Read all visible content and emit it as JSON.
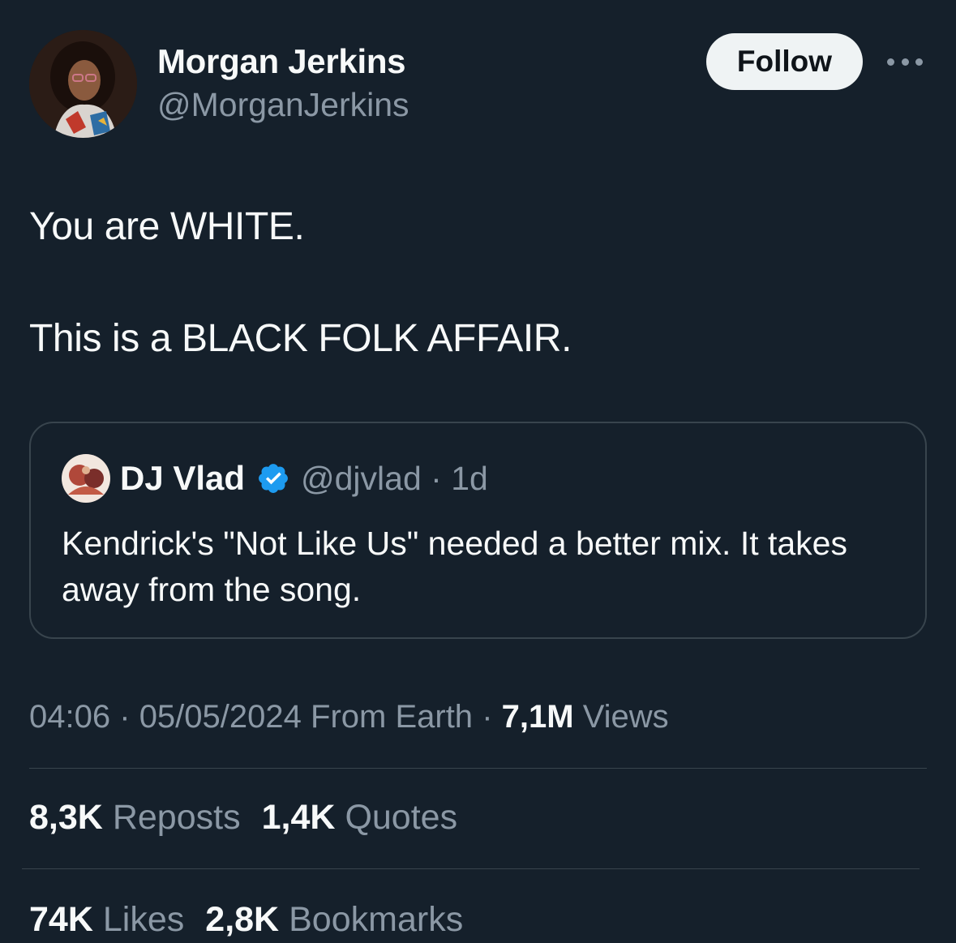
{
  "author": {
    "name": "Morgan Jerkins",
    "handle": "@MorganJerkins"
  },
  "follow_label": "Follow",
  "tweet": {
    "line1": "You are WHITE.",
    "line2": "This is a BLACK FOLK AFFAIR."
  },
  "quote": {
    "name": "DJ Vlad",
    "handle": "@djvlad",
    "separator": "·",
    "age": "1d",
    "text": "Kendrick's \"Not Like Us\" needed a better mix.  It takes away from the song."
  },
  "meta": {
    "time": "04:06",
    "sep1": "·",
    "date": "05/05/2024",
    "source": "From Earth",
    "sep2": "·",
    "views_count": "7,1M",
    "views_label": "Views"
  },
  "stats": {
    "reposts_count": "8,3K",
    "reposts_label": "Reposts",
    "quotes_count": "1,4K",
    "quotes_label": "Quotes",
    "likes_count": "74K",
    "likes_label": "Likes",
    "bookmarks_count": "2,8K",
    "bookmarks_label": "Bookmarks"
  },
  "colors": {
    "background": "#15202b",
    "text": "#f7f9f9",
    "secondary": "#8b98a5",
    "border": "#38444d",
    "verified": "#1d9bf0"
  },
  "icons": [
    "more-icon",
    "verified-badge-icon"
  ]
}
